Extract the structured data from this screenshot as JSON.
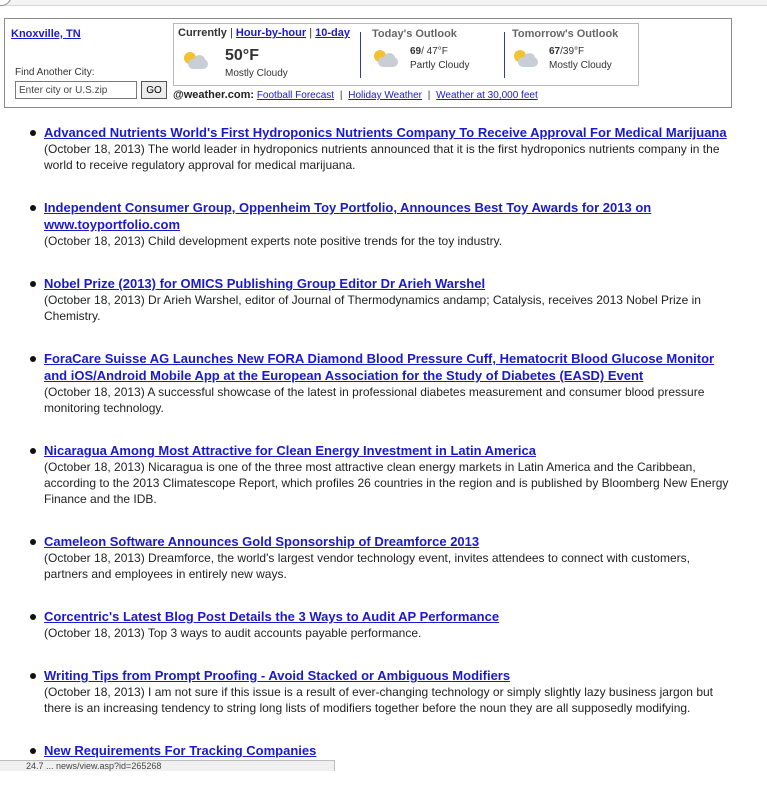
{
  "weather": {
    "city": "Knoxville, TN",
    "find_label": "Find Another City:",
    "input_placeholder": "Enter city or U.S.zip",
    "go_label": "GO",
    "current": {
      "label": "Currently",
      "link_hourly": "Hour-by-hour",
      "link_10day": "10-day",
      "sep": "|",
      "temp": "50°F",
      "condition": "Mostly Cloudy",
      "icon": "partly-cloudy-icon"
    },
    "today": {
      "title": "Today's Outlook",
      "high": "69",
      "low": "/ 47°F",
      "condition": "Partly Cloudy",
      "icon": "partly-cloudy-icon"
    },
    "tomorrow": {
      "title": "Tomorrow's Outlook",
      "high": "67",
      "low": "/39°F",
      "condition": "Mostly Cloudy",
      "icon": "mostly-cloudy-icon"
    },
    "brand": "@weather.com:",
    "links": [
      "Football Forecast",
      "Holiday Weather",
      "Weather at 30,000 feet"
    ],
    "link_sep": "|"
  },
  "news": [
    {
      "title": "Advanced Nutrients World's First Hydroponics Nutrients Company To Receive Approval For Medical Marijuana",
      "summary": "(October 18, 2013) The world leader in hydroponics nutrients announced that it is the first hydroponics nutrients company in the world to receive regulatory approval for medical marijuana."
    },
    {
      "title": "Independent Consumer Group, Oppenheim Toy Portfolio, Announces Best Toy Awards for 2013 on www.toyportfolio.com",
      "summary": "(October 18, 2013) Child development experts note positive trends for the toy industry."
    },
    {
      "title": "Nobel Prize (2013) for OMICS Publishing Group Editor Dr Arieh Warshel",
      "summary": "(October 18, 2013) Dr Arieh Warshel, editor of Journal of Thermodynamics andamp; Catalysis, receives 2013 Nobel Prize in Chemistry."
    },
    {
      "title": "ForaCare Suisse AG Launches New FORA Diamond Blood Pressure Cuff, Hematocrit Blood Glucose Monitor and iOS/Android Mobile App at the European Association for the Study of Diabetes (EASD) Event",
      "summary": "(October 18, 2013) A successful showcase of the latest in professional diabetes measurement and consumer blood pressure monitoring technology."
    },
    {
      "title": "Nicaragua Among Most Attractive for Clean Energy Investment in Latin America",
      "summary": "(October 18, 2013) Nicaragua is one of the three most attractive clean energy markets in Latin America and the Caribbean, according to the 2013 Climatescope Report, which profiles 26 countries in the region and is published by Bloomberg New Energy Finance and the IDB."
    },
    {
      "title": "Cameleon Software Announces Gold Sponsorship of Dreamforce 2013",
      "summary": "(October 18, 2013) Dreamforce, the world's largest vendor technology event, invites attendees to connect with customers, partners and employees in entirely new ways."
    },
    {
      "title": "Corcentric's Latest Blog Post Details the 3 Ways to Audit AP Performance",
      "summary": "(October 18, 2013) Top 3 ways to audit accounts payable performance."
    },
    {
      "title": "Writing Tips from Prompt Proofing - Avoid Stacked or Ambiguous Modifiers",
      "summary": "(October 18, 2013) I am not sure if this issue is a result of ever-changing technology or simply slightly lazy business jargon but there is an increasing tendency to string long lists of modifiers together before the noun they are all supposedly modifying."
    },
    {
      "title": "New Requirements For Tracking Companies",
      "summary": ""
    }
  ],
  "status_bar": "24.7 ... news/view.asp?id=265268"
}
